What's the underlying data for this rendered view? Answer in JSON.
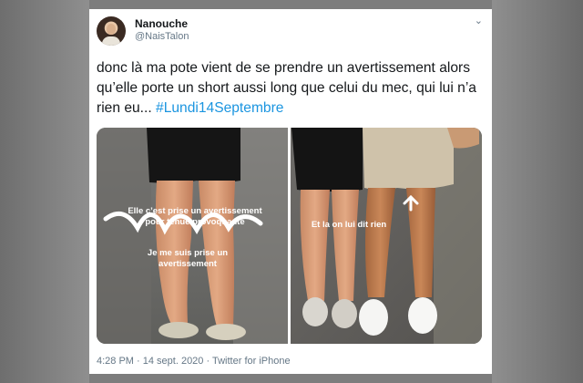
{
  "tweet": {
    "display_name": "Nanouche",
    "handle": "@NaisTalon",
    "text_main": "donc là ma pote vient de se prendre un avertissement alors qu’elle porte un short aussi long que celui du mec, qui lui n’a rien eu... ",
    "hashtag": "#Lundi14Septembre",
    "time": "4:28 PM",
    "separator": " · ",
    "date": "14 sept. 2020",
    "source": "Twitter for iPhone",
    "menu_icon": "chevron-down-icon"
  },
  "media": {
    "left_caption_line1": "Elle c’est prise un avertissement",
    "left_caption_line2": "pour tenue provoquante",
    "left_caption_line3": "Je me suis prise un",
    "left_caption_line4": "avertissement",
    "right_caption": "Et la on lui dit rien"
  },
  "colors": {
    "link": "#1b95e0",
    "text": "#14171a",
    "secondary": "#657786"
  }
}
